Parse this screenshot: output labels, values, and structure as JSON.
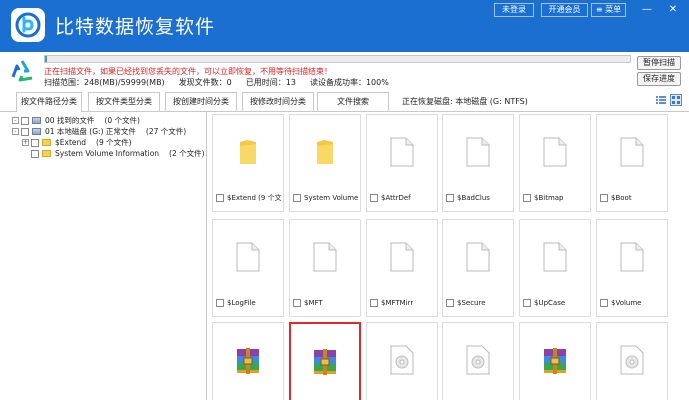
{
  "app": {
    "title": "比特数据恢复软件",
    "login_label": "未登录",
    "vip_label": "开通会员",
    "menu_label": "菜单",
    "menu_icon": "menu-lines-icon",
    "minimize_glyph": "—",
    "close_glyph": "✕"
  },
  "colors": {
    "titlebar": "#1a6fd0",
    "warning": "#e02020",
    "progress": "#3a9be0",
    "selection": "#e02a2a"
  },
  "status": {
    "warning": "正在扫描文件，如果已经找到您丢失的文件，可以立即恢复，不用等待扫描结束！",
    "scope": "扫描范围：248(MB)/59999(MB)",
    "files_found": "发现文件数：0",
    "elapsed": "已用时间：13",
    "read_rate": "读设备成功率：100%",
    "progress_fraction": 0.004,
    "pause_label": "暂停扫描",
    "save_label": "保存进度"
  },
  "tabs": [
    {
      "label": "按文件路径分类",
      "active": true
    },
    {
      "label": "按文件类型分类",
      "active": false
    },
    {
      "label": "按创建时间分类",
      "active": false
    },
    {
      "label": "按修改时间分类",
      "active": false
    },
    {
      "label": "文件搜索",
      "active": false
    }
  ],
  "scan_path": "正在恢复磁盘: 本地磁盘 (G: NTFS)",
  "tree": [
    {
      "expander": "-",
      "name": "00 找到的文件",
      "count": "(0 个文件)",
      "icon": "drive-icon"
    },
    {
      "expander": "-",
      "name": "01 本地磁盘 (G:) 正常文件",
      "count": "(27 个文件)",
      "icon": "drive-icon"
    },
    {
      "expander": "+",
      "name": "$Extend",
      "count": "(9 个文件)",
      "icon": "folder-icon"
    },
    {
      "expander": "",
      "name": "System Volume Information",
      "count": "(2 个文件)",
      "icon": "folder-icon"
    }
  ],
  "files": [
    {
      "name": "$Extend (9 个文...",
      "kind": "folder"
    },
    {
      "name": "System Volume In...",
      "kind": "folder"
    },
    {
      "name": "$AttrDef",
      "kind": "doc"
    },
    {
      "name": "$BadClus",
      "kind": "doc"
    },
    {
      "name": "$Bitmap",
      "kind": "doc"
    },
    {
      "name": "$Boot",
      "kind": "doc"
    },
    {
      "name": "$LogFile",
      "kind": "doc"
    },
    {
      "name": "$MFT",
      "kind": "doc"
    },
    {
      "name": "$MFTMirr",
      "kind": "doc"
    },
    {
      "name": "$Secure",
      "kind": "doc"
    },
    {
      "name": "$UpCase",
      "kind": "doc"
    },
    {
      "name": "$Volume",
      "kind": "doc"
    },
    {
      "name": "",
      "kind": "archive"
    },
    {
      "name": "",
      "kind": "archive",
      "selected": true
    },
    {
      "name": "",
      "kind": "disc"
    },
    {
      "name": "",
      "kind": "disc"
    },
    {
      "name": "",
      "kind": "archive"
    },
    {
      "name": "",
      "kind": "disc"
    }
  ]
}
